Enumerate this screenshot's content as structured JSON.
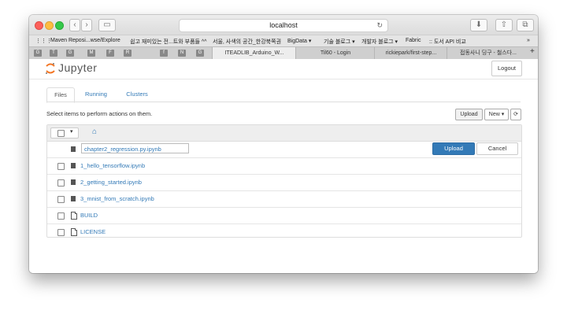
{
  "browser": {
    "url": "localhost",
    "bookmarks": [
      "Maven Reposi...wse/Explore",
      "쉽고 재미있는 전...트와 부품들 ^^",
      "서울, 사색의 공간_한강북쪽권",
      "BigData ▾",
      "기술 블로그 ▾",
      "개발자 블로그 ▾",
      "Fabric",
      ":: 도서 API 비교"
    ],
    "pinned_tabs": [
      "G",
      "T",
      "G",
      "M",
      "F",
      "R",
      "f",
      "N",
      "G"
    ],
    "tabs": [
      "ITEADLIB_Arduino_W...",
      "Til60 - Login",
      "rickiepark/first-step...",
      "접동사니 딩구 - 철스다..."
    ]
  },
  "jupyter": {
    "logo_text": "Jupyter",
    "logout_label": "Logout",
    "tabs": [
      "Files",
      "Running",
      "Clusters"
    ],
    "instructions": "Select items to perform actions on them.",
    "upload_label": "Upload",
    "new_label": "New ▾",
    "refresh_icon": "⟳",
    "home_icon": "⌂",
    "upload_row": {
      "filename": "chapter2_regression.py.ipynb",
      "upload_label": "Upload",
      "cancel_label": "Cancel"
    },
    "files": [
      {
        "name": "1_hello_tensorflow.ipynb",
        "type": "notebook"
      },
      {
        "name": "2_getting_started.ipynb",
        "type": "notebook"
      },
      {
        "name": "3_mnist_from_scratch.ipynb",
        "type": "notebook"
      },
      {
        "name": "BUILD",
        "type": "file"
      },
      {
        "name": "LICENSE",
        "type": "file"
      }
    ]
  }
}
